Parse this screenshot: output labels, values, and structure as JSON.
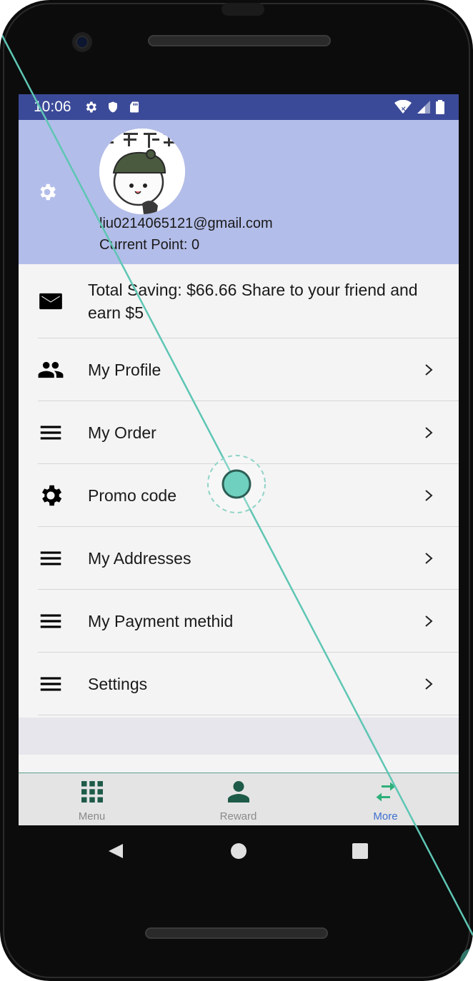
{
  "status_bar": {
    "time": "10:06",
    "left_icons": [
      "gear-icon",
      "shield-icon",
      "sd-card-icon"
    ],
    "right_icons": [
      "wifi-icon",
      "signal-icon",
      "battery-icon"
    ],
    "color": "#3b4a98"
  },
  "header": {
    "background": "#b3bde9",
    "email": "liu0214065121@gmail.com",
    "points": "Current Point: 0"
  },
  "menu": [
    {
      "icon": "mail-icon",
      "label": "Total Saving: $66.66 Share to your friend and earn $5",
      "chevron": false
    },
    {
      "icon": "people-icon",
      "label": "My Profile",
      "chevron": true
    },
    {
      "icon": "hamburger-icon",
      "label": "My Order",
      "chevron": true
    },
    {
      "icon": "gear-icon",
      "label": "Promo code",
      "chevron": true
    },
    {
      "icon": "hamburger-icon",
      "label": "My Addresses",
      "chevron": true
    },
    {
      "icon": "hamburger-icon",
      "label": "My Payment methid",
      "chevron": true
    },
    {
      "icon": "hamburger-icon",
      "label": "Settings",
      "chevron": true
    }
  ],
  "bottom_nav": [
    {
      "icon": "grid-icon",
      "label": "Menu",
      "active": false
    },
    {
      "icon": "person-icon",
      "label": "Reward",
      "active": false
    },
    {
      "icon": "swap-arrows-icon",
      "label": "More",
      "active": true
    }
  ],
  "accent_color": "#3d6fcf",
  "nav_icon_color": "#1e5a48"
}
